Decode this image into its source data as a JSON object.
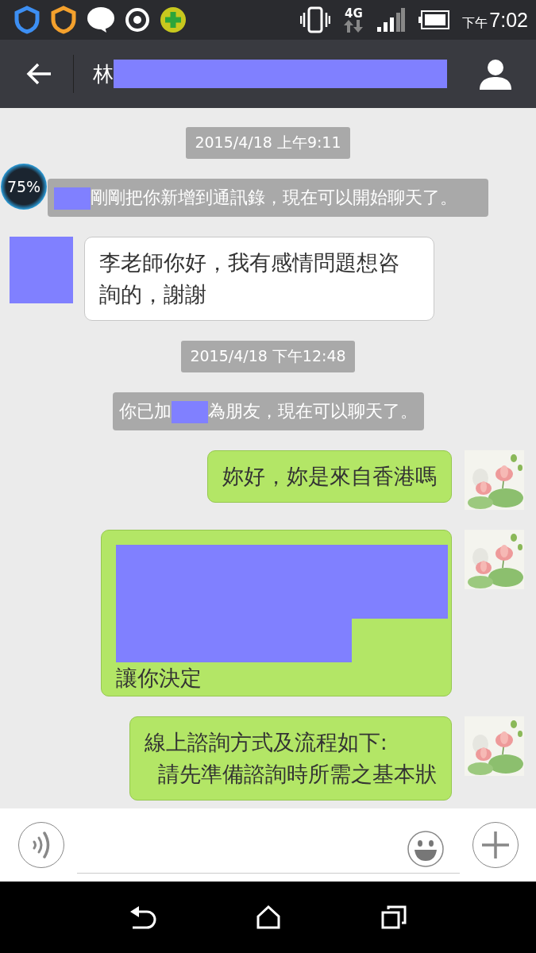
{
  "status_bar": {
    "period": "下午",
    "time": "7:02",
    "network": "4G"
  },
  "header": {
    "title": "林",
    "title_redacted": true
  },
  "floating_widget": {
    "text": "75%"
  },
  "messages": [
    {
      "kind": "date",
      "parts": [
        {
          "kind": "text",
          "text": "2015/4/18 上午9:11"
        }
      ]
    },
    {
      "kind": "system",
      "parts": [
        {
          "kind": "redacted"
        },
        {
          "kind": "text",
          "text": "剛剛把你新增到通訊錄，現在可以開始聊天了。"
        }
      ]
    },
    {
      "kind": "incoming",
      "avatar_redacted": true,
      "parts": [
        {
          "kind": "text",
          "text": "李老師你好，我有感情問題想咨詢的，謝謝"
        }
      ]
    },
    {
      "kind": "date",
      "parts": [
        {
          "kind": "text",
          "text": "2015/4/18 下午12:48"
        }
      ]
    },
    {
      "kind": "system",
      "parts": [
        {
          "kind": "text",
          "text": "你已加"
        },
        {
          "kind": "redacted"
        },
        {
          "kind": "text",
          "text": "為朋友，現在可以聊天了。"
        }
      ]
    },
    {
      "kind": "outgoing",
      "parts": [
        {
          "kind": "text",
          "text": "妳好，妳是來自香港嗎"
        }
      ]
    },
    {
      "kind": "outgoing",
      "parts": [
        {
          "kind": "redacted_large"
        },
        {
          "kind": "redacted_wide"
        },
        {
          "kind": "text",
          "text": "讓你決定"
        }
      ]
    },
    {
      "kind": "outgoing",
      "parts": [
        {
          "kind": "text",
          "text": "線上諮詢方式及流程如下:\n  請先準備諮詢時所需之基本狀"
        }
      ]
    }
  ]
}
